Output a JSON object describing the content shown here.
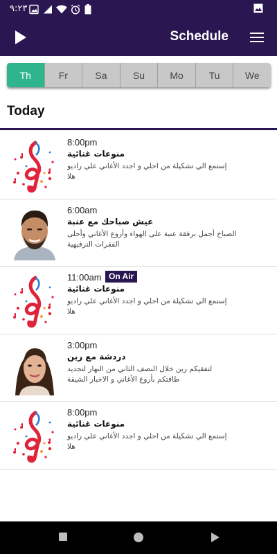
{
  "status_bar": {
    "time": "٩:٢٣",
    "icons": [
      "gallery-icon",
      "signal-icon",
      "wifi-icon",
      "alarm-icon",
      "battery-icon",
      "image-icon"
    ]
  },
  "header": {
    "title": "Schedule",
    "play_icon": "play-icon",
    "menu_icon": "hamburger-menu-icon"
  },
  "days": {
    "items": [
      "Th",
      "Fr",
      "Sa",
      "Su",
      "Mo",
      "Tu",
      "We"
    ],
    "active": "Th"
  },
  "section_title": "Today",
  "shows": [
    {
      "time": "8:00pm",
      "title": "منوعات غنائية",
      "description": "إستمع الي تشكيلة من احلي و اجدد الأغاني علي راديو هلا",
      "thumb": "music-note-thumbnail",
      "on_air": ""
    },
    {
      "time": "6:00am",
      "title": "عيش صباحك مع عنبة",
      "description": "الصباح أجمل برفقة عنبة على الهواء وأروع الأغاني وأحلى الفقرات الترفيهية",
      "thumb": "host-photo-male",
      "on_air": ""
    },
    {
      "time": "11:00am",
      "title": "منوعات غنائية",
      "description": "إستمع الي تشكيلة من احلي و اجدد الأغاني علي راديو هلا",
      "thumb": "music-note-thumbnail",
      "on_air": "On Air"
    },
    {
      "time": "3:00pm",
      "title": "دردشة مع رين",
      "description": "لتفقيكم رين خلال النصف الثاني من النهار لتجديد طاقتكم بأروع الأغاني و الاخبار الشيقة",
      "thumb": "host-photo-female",
      "on_air": ""
    },
    {
      "time": "8:00pm",
      "title": "منوعات غنائية",
      "description": "إستمع الي تشكيلة من احلي و اجدد الأغاني علي راديو هلا",
      "thumb": "music-note-thumbnail",
      "on_air": ""
    }
  ],
  "colors": {
    "brand": "#2a1651",
    "active_tab": "#2eb58e",
    "inactive_tab": "#c8c8c8"
  },
  "nav_bar": [
    "recents-square-icon",
    "home-circle-icon",
    "back-triangle-icon"
  ]
}
